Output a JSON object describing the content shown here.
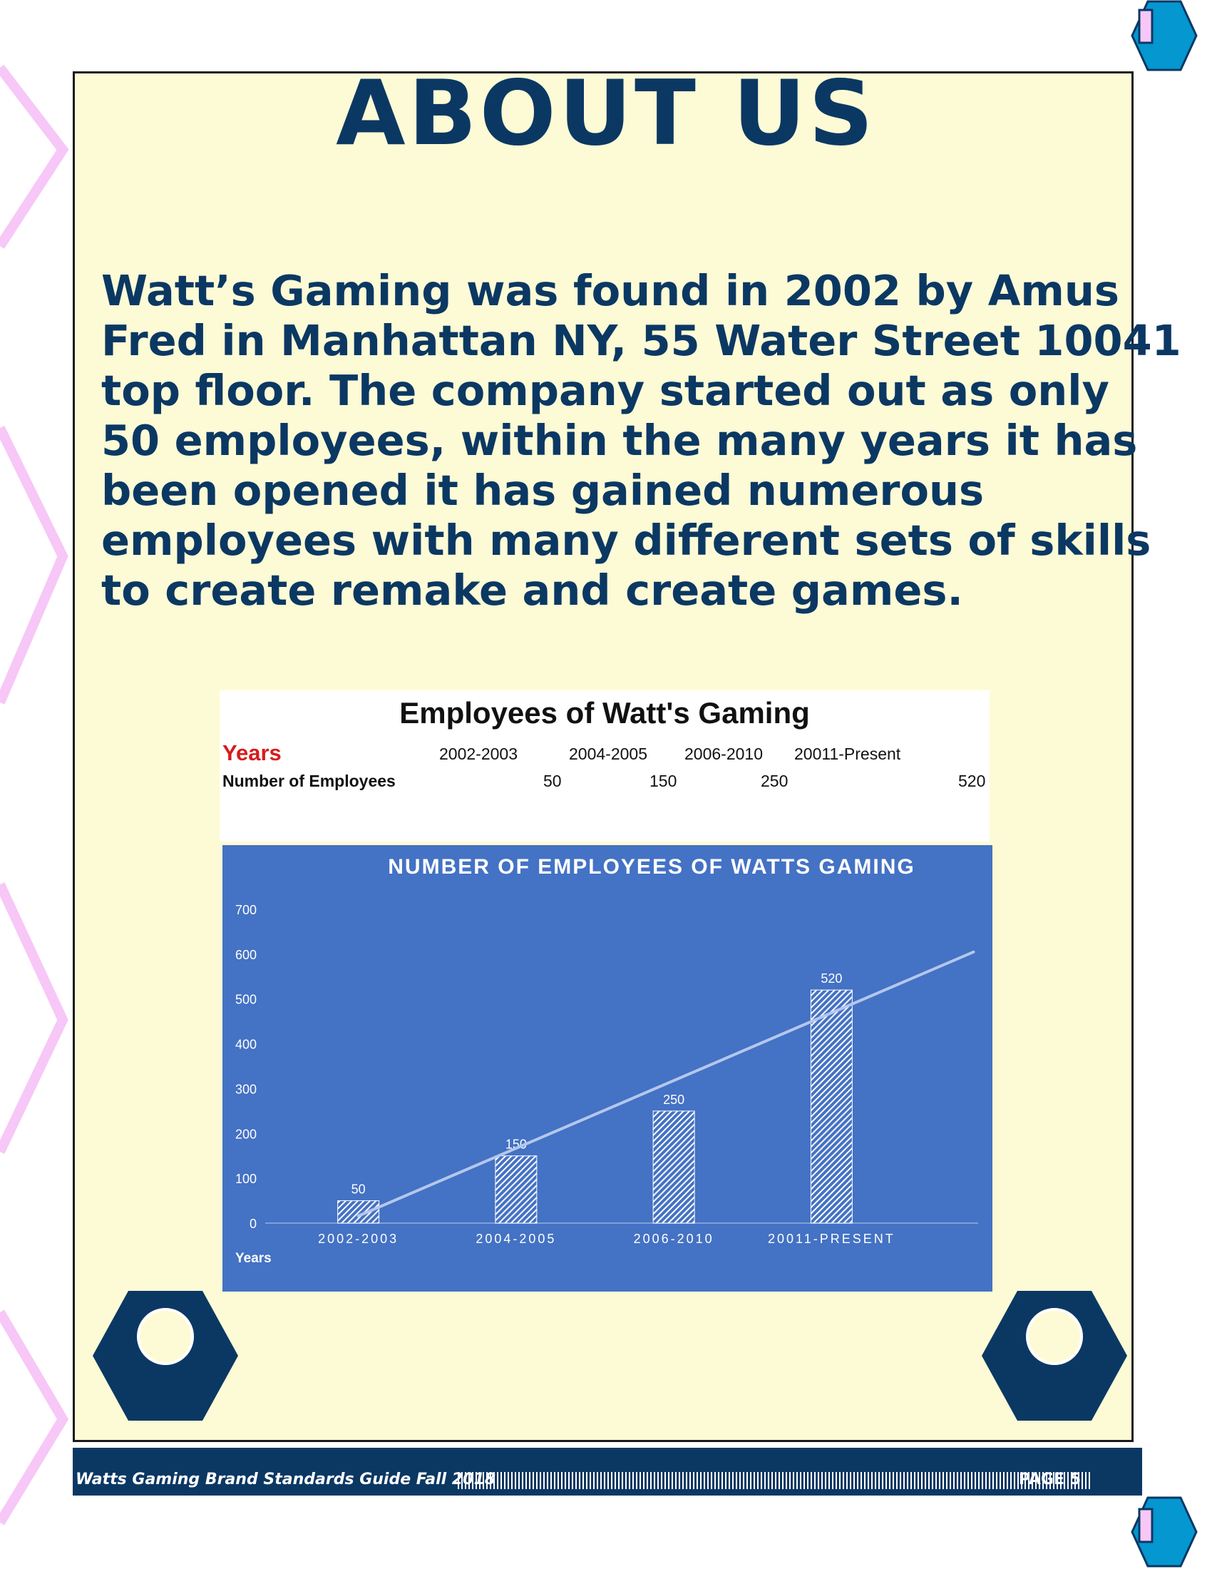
{
  "page": {
    "title": "ABOUT US",
    "intro_lines": [
      "Watt’s Gaming was found in 2002 by Amus",
      "Fred in Manhattan NY,  55 Water Street 10041",
      "top floor. The company started out as only",
      "50 employees, within the many years it has",
      "been opened it has gained numerous",
      "employees with many different sets of skills",
      "to create remake and create games."
    ]
  },
  "employee_table": {
    "title": "Employees of Watt's Gaming",
    "row1_label": "Years",
    "row2_label": "Number of Employees",
    "years": [
      "2002-2003",
      "2004-2005",
      "2006-2010",
      "20011-Present"
    ],
    "counts": [
      "50",
      "150",
      "250",
      "520"
    ]
  },
  "chart_data": {
    "type": "bar",
    "title": "NUMBER OF EMPLOYEES OF WATTS GAMING",
    "xlabel": "Years",
    "ylabel": "",
    "categories": [
      "2002-2003",
      "2004-2005",
      "2006-2010",
      "20011-PRESENT"
    ],
    "values": [
      50,
      150,
      250,
      520
    ],
    "data_labels": [
      "50",
      "150",
      "250",
      "520"
    ],
    "ylim": [
      0,
      700
    ],
    "yticks": [
      0,
      100,
      200,
      300,
      400,
      500,
      600,
      700
    ],
    "trendline": "linear",
    "grid": false,
    "legend": "none",
    "colors": {
      "background": "#4472c4",
      "bar_fill": "#ffffff",
      "text": "#ffffff"
    }
  },
  "footer": {
    "text": "Watts Gaming Brand Standards Guide Fall 2018",
    "page": "PAGE 5"
  },
  "colors": {
    "navy": "#0b3863",
    "cream": "#fdfbd6",
    "accent_blue": "#0497d0",
    "accent_pink": "#f7c7f7",
    "red_label": "#d81b1b"
  }
}
